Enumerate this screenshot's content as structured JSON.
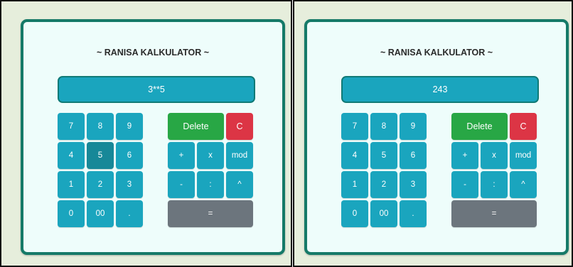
{
  "panels": [
    {
      "title": "~ RANISA KALKULATOR ~",
      "display": "3**5",
      "numpad": [
        "7",
        "8",
        "9",
        "4",
        "5",
        "6",
        "1",
        "2",
        "3",
        "0",
        "00",
        "."
      ],
      "delete_label": "Delete",
      "clear_label": "C",
      "operators": [
        "+",
        "x",
        "mod",
        "-",
        ":",
        "^"
      ],
      "equals_label": "=",
      "pressed_key": "5"
    },
    {
      "title": "~ RANISA KALKULATOR ~",
      "display": "243",
      "numpad": [
        "7",
        "8",
        "9",
        "4",
        "5",
        "6",
        "1",
        "2",
        "3",
        "0",
        "00",
        "."
      ],
      "delete_label": "Delete",
      "clear_label": "C",
      "operators": [
        "+",
        "x",
        "mod",
        "-",
        ":",
        "^"
      ],
      "equals_label": "=",
      "pressed_key": ""
    }
  ],
  "colors": {
    "page_background": "#e6eedc",
    "calculator_background": "#eefdfb",
    "calculator_border": "#157a68",
    "key": "#1aa5be",
    "key_pressed": "#178898",
    "delete": "#28a745",
    "clear": "#dc3545",
    "equals": "#6c757d"
  }
}
